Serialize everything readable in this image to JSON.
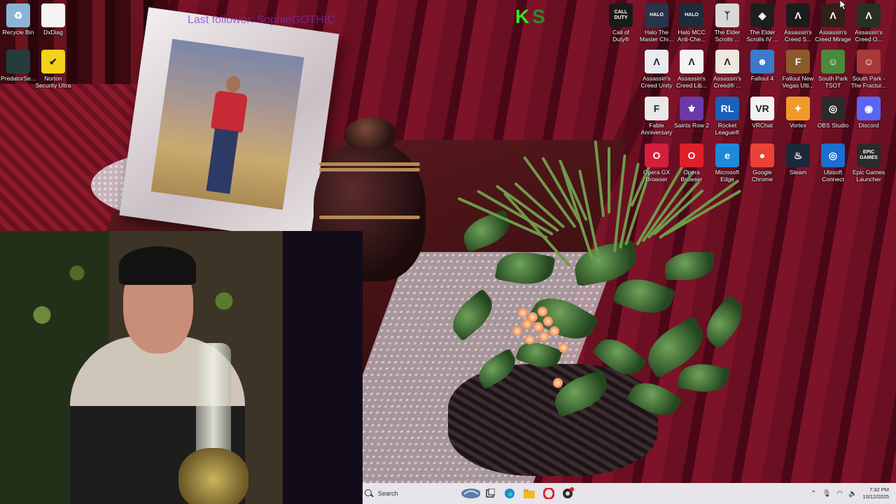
{
  "watermark": "Last follower: SophieGOTHIC",
  "green_logo": {
    "left": "K",
    "right": "S"
  },
  "desktop_left": [
    {
      "name": "recycle-bin",
      "label": "Recycle Bin",
      "glyph": "♻",
      "color": "#8ab4d6"
    },
    {
      "name": "dxdiag",
      "label": "DxDiag",
      "glyph": "",
      "color": "#f4f4f4"
    },
    {
      "name": "predatorsense",
      "label": "PredatorSe...",
      "glyph": "",
      "color": "#243c3c"
    },
    {
      "name": "norton",
      "label": "Norton\nSecurity Ultra",
      "glyph": "✔",
      "color": "#f4d21c"
    }
  ],
  "desktop_right": [
    {
      "name": "call-of-duty",
      "label": "Call of\nDuty®",
      "glyph": "CALL\nDUTY",
      "color": "#1a1a1a"
    },
    {
      "name": "halo-master-chief",
      "label": "Halo The\nMaster Chi...",
      "glyph": "HALO",
      "color": "#28344a"
    },
    {
      "name": "halo-mcc",
      "label": "Halo MCC\nAnti-Che...",
      "glyph": "HALO",
      "color": "#1f2a3a"
    },
    {
      "name": "elder-scrolls-skyrim",
      "label": "The Elder\nScrolls ...",
      "glyph": "ᛉ",
      "color": "#d8d8d8"
    },
    {
      "name": "elder-scrolls-iv",
      "label": "The Elder\nScrolls IV ...",
      "glyph": "◈",
      "color": "#1e1e1e"
    },
    {
      "name": "assassins-creed-s",
      "label": "Assassin's\nCreed S...",
      "glyph": "Λ",
      "color": "#1c1c1c"
    },
    {
      "name": "assassins-creed-mirage",
      "label": "Assassin's\nCreed Mirage",
      "glyph": "Λ",
      "color": "#302016"
    },
    {
      "name": "assassins-creed-o",
      "label": "Assassin's\nCreed O...",
      "glyph": "Λ",
      "color": "#283024"
    },
    {
      "name": "assassins-creed-unity",
      "label": "Assassin's\nCreed Unity",
      "glyph": "Λ",
      "color": "#e8eaf0"
    },
    {
      "name": "assassins-creed-lib",
      "label": "Assassin's\nCreed Lib...",
      "glyph": "Λ",
      "color": "#f3f3f3"
    },
    {
      "name": "assassins-creed-r",
      "label": "Assassin's\nCreed® ...",
      "glyph": "Λ",
      "color": "#ece8de"
    },
    {
      "name": "fallout-4",
      "label": "Fallout 4",
      "glyph": "☻",
      "color": "#3a7ac8"
    },
    {
      "name": "fallout-new-vegas",
      "label": "Fallout New\nVegas Ulti...",
      "glyph": "F",
      "color": "#8a5a2a"
    },
    {
      "name": "south-park-tsot",
      "label": "South Park\nTSOT",
      "glyph": "☺",
      "color": "#4a8a3a"
    },
    {
      "name": "south-park-fractured",
      "label": "South Park -\nThe Fractur...",
      "glyph": "☺",
      "color": "#a83a3a"
    },
    {
      "name": "fable-anniversary",
      "label": "Fable\nAnniversary",
      "glyph": "F",
      "color": "#e8e8e8"
    },
    {
      "name": "saints-row-2",
      "label": "Saints Row 2",
      "glyph": "⚜",
      "color": "#6a3aa8"
    },
    {
      "name": "rocket-league",
      "label": "Rocket\nLeague®",
      "glyph": "RL",
      "color": "#1b5fb8"
    },
    {
      "name": "vrchat",
      "label": "VRChat",
      "glyph": "VR",
      "color": "#f2f2f2"
    },
    {
      "name": "vortex",
      "label": "Vortex",
      "glyph": "✦",
      "color": "#f09a2a"
    },
    {
      "name": "obs-studio",
      "label": "OBS Studio",
      "glyph": "◎",
      "color": "#2b2b2b"
    },
    {
      "name": "discord",
      "label": "Discord",
      "glyph": "◉",
      "color": "#5865f2"
    },
    {
      "name": "opera-gx",
      "label": "Opera GX\nBrowser",
      "glyph": "O",
      "color": "#d21f3c"
    },
    {
      "name": "opera-browser",
      "label": "Opera\nBrowser",
      "glyph": "O",
      "color": "#e01e2a"
    },
    {
      "name": "microsoft-edge",
      "label": "Microsoft\nEdge",
      "glyph": "e",
      "color": "#1d8ad8"
    },
    {
      "name": "google-chrome",
      "label": "Google\nChrome",
      "glyph": "●",
      "color": "#ea4335"
    },
    {
      "name": "steam",
      "label": "Steam",
      "glyph": "♨",
      "color": "#1b2838"
    },
    {
      "name": "ubisoft-connect",
      "label": "Ubisoft\nConnect",
      "glyph": "◎",
      "color": "#1a6fd0"
    },
    {
      "name": "epic-games",
      "label": "Epic Games\nLauncher",
      "glyph": "EPIC\nGAMES",
      "color": "#2a2a2a"
    }
  ],
  "taskbar": {
    "search_label": "Search",
    "time": "7:32 PM",
    "date": "10/12/2025"
  }
}
